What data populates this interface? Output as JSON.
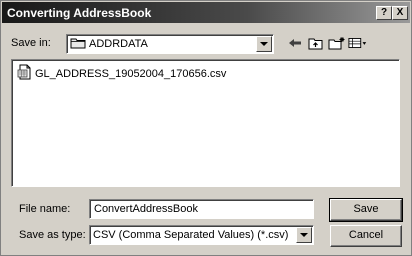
{
  "window": {
    "title": "Converting AddressBook",
    "help_label": "?",
    "close_label": "X"
  },
  "save_in": {
    "label": "Save in:",
    "value": "ADDRDATA"
  },
  "files": [
    {
      "name": "GL_ADDRESS_19052004_170656.csv"
    }
  ],
  "file_name": {
    "label": "File name:",
    "value": "ConvertAddressBook"
  },
  "save_as_type": {
    "label": "Save as type:",
    "value": "CSV (Comma Separated Values) (*.csv)"
  },
  "buttons": {
    "save": "Save",
    "cancel": "Cancel"
  }
}
